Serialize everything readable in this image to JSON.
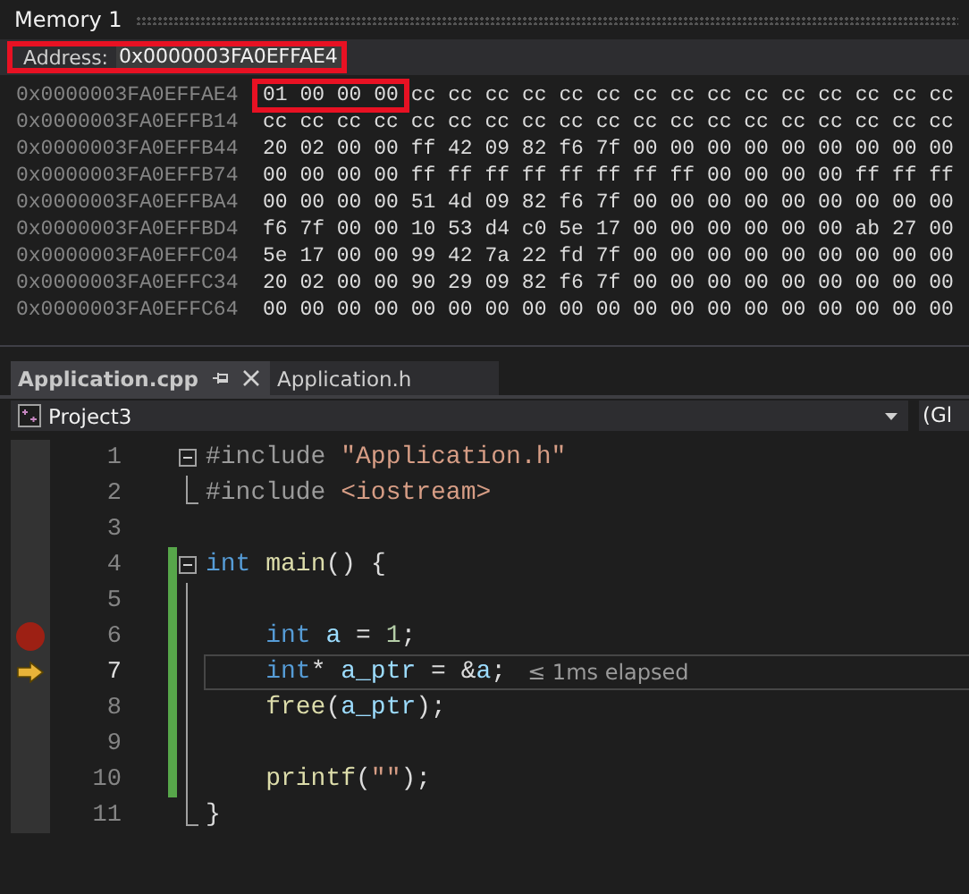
{
  "memory_window": {
    "title": "Memory 1",
    "address": {
      "label": "Address:",
      "value": "0x0000003FA0EFFAE4",
      "highlighted": true
    },
    "rows": [
      {
        "address": "0x0000003FA0EFFAE4",
        "groups": [
          {
            "bytes": "01 00 00 00",
            "highlighted": true
          },
          {
            "bytes": "cc cc cc cc cc cc cc cc cc cc cc cc cc cc cc",
            "highlighted": false
          }
        ]
      },
      {
        "address": "0x0000003FA0EFFB14",
        "groups": [
          {
            "bytes": "cc cc cc cc cc cc cc cc cc cc cc cc cc cc cc cc cc cc cc",
            "highlighted": false
          }
        ]
      },
      {
        "address": "0x0000003FA0EFFB44",
        "groups": [
          {
            "bytes": "20 02 00 00 ff 42 09 82 f6 7f 00 00 00 00 00 00 00 00 00",
            "highlighted": false
          }
        ]
      },
      {
        "address": "0x0000003FA0EFFB74",
        "groups": [
          {
            "bytes": "00 00 00 00 ff ff ff ff ff ff ff ff 00 00 00 00 ff ff ff",
            "highlighted": false
          }
        ]
      },
      {
        "address": "0x0000003FA0EFFBA4",
        "groups": [
          {
            "bytes": "00 00 00 00 51 4d 09 82 f6 7f 00 00 00 00 00 00 00 00 00",
            "highlighted": false
          }
        ]
      },
      {
        "address": "0x0000003FA0EFFBD4",
        "groups": [
          {
            "bytes": "f6 7f 00 00 10 53 d4 c0 5e 17 00 00 00 00 00 00 ab 27 00",
            "highlighted": false
          }
        ]
      },
      {
        "address": "0x0000003FA0EFFC04",
        "groups": [
          {
            "bytes": "5e 17 00 00 99 42 7a 22 fd 7f 00 00 00 00 00 00 00 00 00",
            "highlighted": false
          }
        ]
      },
      {
        "address": "0x0000003FA0EFFC34",
        "groups": [
          {
            "bytes": "20 02 00 00 90 29 09 82 f6 7f 00 00 00 00 00 00 00 00 00",
            "highlighted": false
          }
        ]
      },
      {
        "address": "0x0000003FA0EFFC64",
        "groups": [
          {
            "bytes": "00 00 00 00 00 00 00 00 00 00 00 00 00 00 00 00 00 00 00",
            "highlighted": false
          }
        ]
      }
    ]
  },
  "tabs": [
    {
      "label": "Application.cpp",
      "selected": true
    },
    {
      "label": "Application.h",
      "selected": false
    }
  ],
  "navigation_bar": {
    "project": "Project3",
    "scope": "(Gl"
  },
  "editor": {
    "lines": [
      {
        "number": "1",
        "kind": "fold_start",
        "indented": false,
        "changed": false,
        "breakpoint": false,
        "current": false,
        "tokens": [
          {
            "kind": "preproc",
            "text": "#include"
          },
          {
            "kind": "string",
            "text": " \"Application.h\""
          }
        ]
      },
      {
        "number": "2",
        "kind": "fold_end",
        "indented": false,
        "changed": false,
        "breakpoint": false,
        "current": false,
        "tokens": [
          {
            "kind": "preproc",
            "text": "#include"
          },
          {
            "kind": "string",
            "text": " <iostream>"
          }
        ]
      },
      {
        "number": "3",
        "kind": "plain",
        "changed": false,
        "breakpoint": false,
        "current": false
      },
      {
        "number": "4",
        "kind": "fold_start",
        "indented": false,
        "changed": true,
        "breakpoint": false,
        "current": false,
        "tokens": [
          {
            "kind": "keyword",
            "text": "int"
          },
          {
            "kind": "function",
            "text": " main"
          },
          {
            "kind": "plain",
            "text": "() {"
          }
        ]
      },
      {
        "number": "5",
        "kind": "fold_line",
        "changed": true,
        "breakpoint": false,
        "current": false
      },
      {
        "number": "6",
        "kind": "fold_line",
        "indented": true,
        "changed": true,
        "breakpoint": true,
        "current": false,
        "tokens": [
          {
            "kind": "keyword",
            "text": "int"
          },
          {
            "kind": "variable",
            "text": " a"
          },
          {
            "kind": "plain",
            "text": " = "
          },
          {
            "kind": "number",
            "text": "1"
          },
          {
            "kind": "plain",
            "text": ";"
          }
        ]
      },
      {
        "number": "7",
        "kind": "fold_line",
        "indented": true,
        "changed": true,
        "breakpoint": false,
        "current": true,
        "hint": "≤ 1ms elapsed",
        "tokens": [
          {
            "kind": "keyword",
            "text": "int"
          },
          {
            "kind": "plain",
            "text": "*"
          },
          {
            "kind": "variable",
            "text": " a_ptr"
          },
          {
            "kind": "plain",
            "text": " = &"
          },
          {
            "kind": "variable",
            "text": "a"
          },
          {
            "kind": "plain",
            "text": ";"
          }
        ]
      },
      {
        "number": "8",
        "kind": "fold_line",
        "indented": true,
        "changed": true,
        "breakpoint": false,
        "current": false,
        "tokens": [
          {
            "kind": "function",
            "text": "free"
          },
          {
            "kind": "plain",
            "text": "("
          },
          {
            "kind": "variable",
            "text": "a_ptr"
          },
          {
            "kind": "plain",
            "text": ");"
          }
        ]
      },
      {
        "number": "9",
        "kind": "fold_line",
        "changed": true,
        "breakpoint": false,
        "current": false
      },
      {
        "number": "10",
        "kind": "fold_line",
        "indented": true,
        "changed": true,
        "breakpoint": false,
        "current": false,
        "tokens": [
          {
            "kind": "function",
            "text": "printf"
          },
          {
            "kind": "plain",
            "text": "("
          },
          {
            "kind": "string",
            "text": "\"\""
          },
          {
            "kind": "plain",
            "text": ");"
          }
        ]
      },
      {
        "number": "11",
        "kind": "fold_end",
        "indented": false,
        "changed": false,
        "breakpoint": false,
        "current": false,
        "tokens": [
          {
            "kind": "plain",
            "text": "}"
          }
        ]
      }
    ]
  }
}
